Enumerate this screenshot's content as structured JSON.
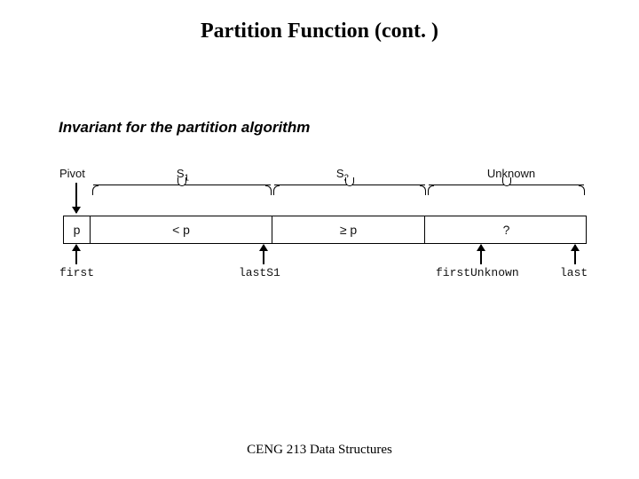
{
  "title": "Partition Function (cont. )",
  "subtitle": "Invariant for the partition algorithm",
  "labels_top": {
    "pivot": "Pivot",
    "s1": "S",
    "s1_sub": "1",
    "s2": "S",
    "s2_sub": "2",
    "unknown": "Unknown"
  },
  "cells": {
    "pivot": "p",
    "lt": "< p",
    "ge": "≥ p",
    "unknown": "?"
  },
  "labels_bottom": {
    "first": "first",
    "lastS1": "lastS1",
    "firstUnknown": "firstUnknown",
    "last": "last"
  },
  "footer": "CENG 213 Data Structures"
}
